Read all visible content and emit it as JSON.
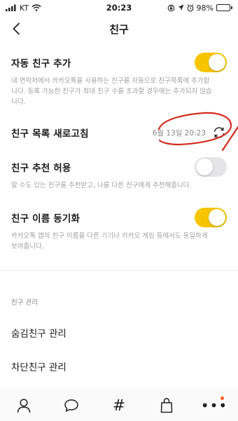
{
  "status_bar": {
    "carrier": "KT",
    "time": "20:23",
    "battery_percent_label": "98%",
    "battery_level": 0.98
  },
  "header": {
    "title": "친구",
    "back_icon": "chevron-left-icon"
  },
  "settings": {
    "auto_add": {
      "title": "자동 친구 추가",
      "description": "내 연락처에서 카카오톡을 사용하는 친구를 자동으로 친구목록에 추가합니다. 등록 가능한 친구가 최대 친구 수를 초과할 경우에는 추가되지 않습니다.",
      "enabled": true
    },
    "refresh": {
      "title": "친구 목록 새로고침",
      "last_refreshed": "6월 13일 20:23",
      "icon": "refresh-icon"
    },
    "recommend": {
      "title": "친구 추천 허용",
      "description": "알 수도 있는 친구를 추천받고, 나를 다른 친구에게 추천해줍니다.",
      "enabled": false
    },
    "name_sync": {
      "title": "친구 이름 동기화",
      "description": "카카오톡 앱의 친구 이름을 다른 기기나 카카오 게임 등에서도 동일하게 보여줍니다.",
      "enabled": true
    }
  },
  "management": {
    "section_label": "친구 관리",
    "hidden_friends": "숨김친구 관리",
    "blocked_friends": "차단친구 관리"
  },
  "tab_bar": {
    "tabs": [
      "person-icon",
      "chat-bubble-icon",
      "hashtag-icon",
      "shopping-bag-icon",
      "more-icon"
    ],
    "hash_glyph": "#",
    "more_glyph": "•••"
  },
  "colors": {
    "toggle_on": "#f6c500",
    "toggle_off": "#e5e5e7",
    "annotation": "#d42a1e",
    "badge": "#ff5a2a"
  }
}
